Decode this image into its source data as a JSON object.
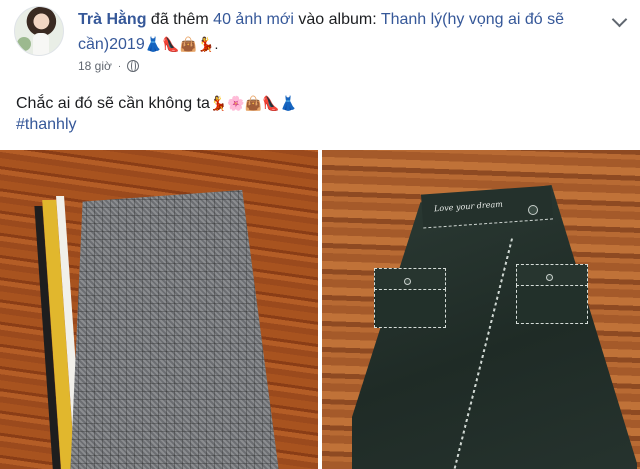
{
  "post": {
    "author": "Trà Hằng",
    "action_text": " đã thêm ",
    "album_count_link": "40 ảnh mới",
    "album_prefix": " vào album: ",
    "album_name": "Thanh lý(hy vọng ai đó sẽ cần)2019",
    "album_emojis": "👗👠👜💃.",
    "timestamp": "18 giờ",
    "separator": "·",
    "privacy_icon": "globe-icon",
    "caption_text": "Chắc ai đó sẽ cần không ta",
    "caption_emojis": "💃🌸👜👠👗",
    "hashtag": "#thanhly"
  },
  "photos": [
    {
      "icon": "grey-plaid-pencil-skirt"
    },
    {
      "icon": "dark-green-wrap-skirt",
      "embroidery": "Love your dream"
    }
  ],
  "colors": {
    "link": "#365899",
    "text": "#1c1e21",
    "meta": "#616770"
  }
}
